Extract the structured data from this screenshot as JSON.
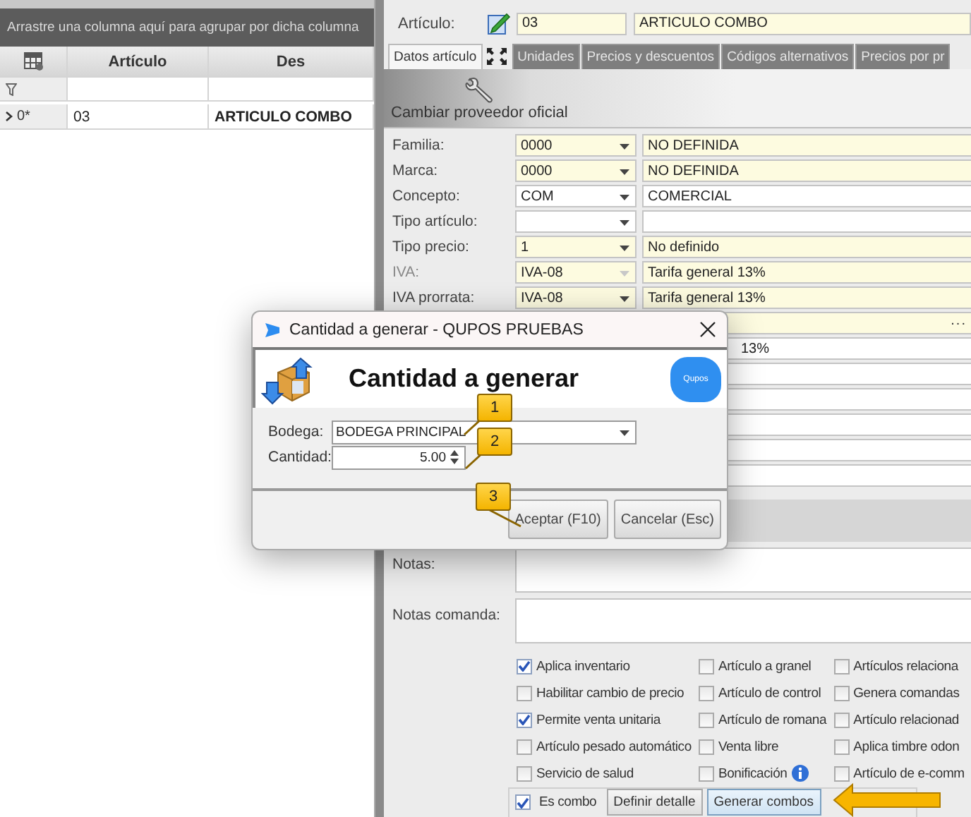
{
  "grid": {
    "group_hint": "Arrastre una columna aquí para agrupar por dicha columna",
    "columns": [
      "Artículo",
      "Des"
    ],
    "rows": [
      {
        "indicator": "0*",
        "cells": [
          "03",
          "ARTICULO COMBO"
        ]
      }
    ]
  },
  "article": {
    "label": "Artículo:",
    "code": "03",
    "description": "ARTICULO COMBO"
  },
  "tabs": [
    {
      "label": "Datos artículo",
      "selected": true
    },
    {
      "label": "Unidades",
      "selected": false
    },
    {
      "label": "Precios y descuentos",
      "selected": false
    },
    {
      "label": "Códigos alternativos",
      "selected": false
    },
    {
      "label": "Precios por pr",
      "selected": false
    }
  ],
  "toolbar": {
    "button": "Cambiar proveedor oficial"
  },
  "fields": [
    {
      "kind": "dropdown",
      "label": "Familia:",
      "code": "0000",
      "description": "NO DEFINIDA",
      "highlighted": true,
      "disabled": false
    },
    {
      "kind": "dropdown",
      "label": "Marca:",
      "code": "0000",
      "description": "NO DEFINIDA",
      "highlighted": true,
      "disabled": false
    },
    {
      "kind": "dropdown",
      "label": "Concepto:",
      "code": "COM",
      "description": "COMERCIAL",
      "highlighted": false,
      "disabled": false
    },
    {
      "kind": "dropdown",
      "label": "Tipo artículo:",
      "highlighted": false,
      "disabled": false
    },
    {
      "kind": "dropdown",
      "label": "Tipo precio:",
      "code": "1",
      "description": "No definido",
      "highlighted": true,
      "disabled": false
    },
    {
      "kind": "dropdown",
      "label": "IVA:",
      "code": "IVA-08",
      "description": "Tarifa general 13%",
      "highlighted": true,
      "disabled": true
    },
    {
      "kind": "dropdown",
      "label": "IVA prorrata:",
      "code": "IVA-08",
      "description": "Tarifa general 13%",
      "highlighted": true,
      "disabled": false
    },
    {
      "kind": "covered",
      "button": "...",
      "highlighted": true
    },
    {
      "kind": "covered",
      "description": "13%",
      "highlighted": false
    },
    {
      "kind": "covered",
      "highlighted": false
    },
    {
      "kind": "covered",
      "highlighted": false
    },
    {
      "kind": "covered",
      "highlighted": false
    },
    {
      "kind": "covered",
      "highlighted": false
    },
    {
      "kind": "covered",
      "highlighted": false
    }
  ],
  "notes": [
    {
      "label": "Notas:"
    },
    {
      "label": "Notas comanda:"
    }
  ],
  "options": [
    {
      "label": "Aplica inventario",
      "checked": true
    },
    {
      "label": "Artículo a granel",
      "checked": false
    },
    {
      "label": "Artículos relaciona",
      "checked": false
    },
    {
      "label": "Habilitar cambio de precio",
      "checked": false
    },
    {
      "label": "Artículo de control",
      "checked": false
    },
    {
      "label": "Genera comandas",
      "checked": false
    },
    {
      "label": "Permite venta unitaria",
      "checked": true
    },
    {
      "label": "Artículo de romana",
      "checked": false
    },
    {
      "label": "Artículo relacionad",
      "checked": false
    },
    {
      "label": "Artículo pesado automático",
      "checked": false
    },
    {
      "label": "Venta libre",
      "checked": false
    },
    {
      "label": "Aplica timbre odon",
      "checked": false
    },
    {
      "label": "Servicio de salud",
      "checked": false
    },
    {
      "label": "Bonificación",
      "checked": false,
      "info": true
    },
    {
      "label": "Artículo de e-comm",
      "checked": false
    }
  ],
  "combo": {
    "label": "Es combo",
    "checked": true,
    "buttons": [
      "Definir detalle",
      "Generar combos"
    ]
  },
  "dialog": {
    "title": "Cantidad a generar - QUPOS PRUEBAS",
    "heading": "Cantidad a generar",
    "logo_text": "Qupos",
    "fields": [
      {
        "kind": "dropdown",
        "label": "Bodega:",
        "value": "BODEGA PRINCIPAL"
      },
      {
        "kind": "spinner",
        "label": "Cantidad:",
        "value": "5.00"
      }
    ],
    "buttons": [
      "Aceptar (F10)",
      "Cancelar (Esc)"
    ],
    "callouts": [
      "1",
      "2",
      "3"
    ]
  }
}
